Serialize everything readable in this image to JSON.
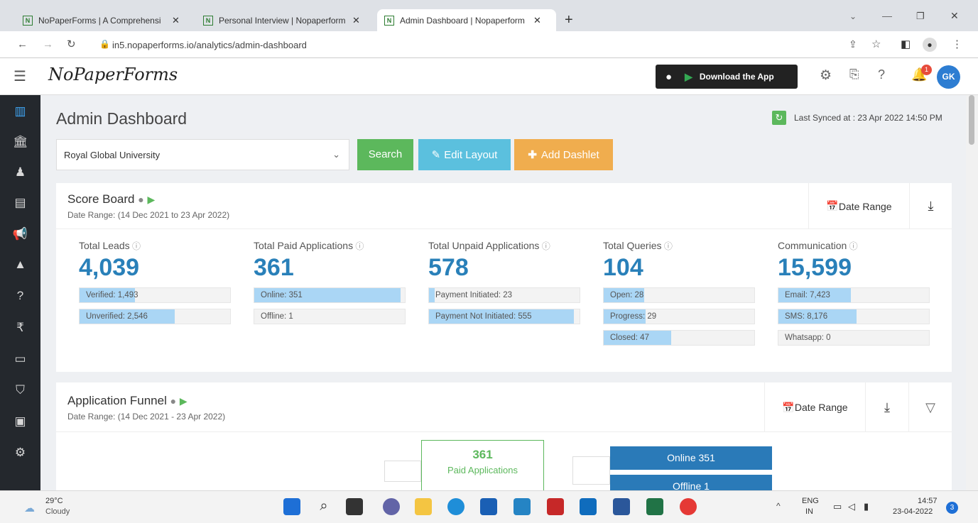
{
  "browser": {
    "tabs": [
      {
        "title": "NoPaperForms | A Comprehensi"
      },
      {
        "title": "Personal Interview | Nopaperform"
      },
      {
        "title": "Admin Dashboard | Nopaperform"
      }
    ],
    "url": "in5.nopaperforms.io/analytics/admin-dashboard",
    "fav_letter": "N"
  },
  "header": {
    "logo": "NoPaperForms",
    "download_label": "Download the App",
    "notif_count": "1",
    "avatar": "GK"
  },
  "page": {
    "title": "Admin Dashboard",
    "sync": "Last Synced at : 23 Apr 2022 14:50 PM",
    "university": "Royal Global University",
    "search_label": "Search",
    "edit_label": "Edit Layout",
    "add_label": "Add Dashlet"
  },
  "scoreboard": {
    "title": "Score Board",
    "date_range": "Date Range: (14 Dec 2021 to 23 Apr 2022)",
    "range_btn": "Date Range",
    "metrics": [
      {
        "label": "Total Leads",
        "value": "4,039",
        "bars": [
          {
            "text": "Verified: 1,493",
            "pct": 0.37
          },
          {
            "text": "Unverified: 2,546",
            "pct": 0.63
          }
        ]
      },
      {
        "label": "Total Paid Applications",
        "value": "361",
        "bars": [
          {
            "text": "Online: 351",
            "pct": 0.97
          },
          {
            "text": "Offline: 1",
            "pct": 0.0
          }
        ]
      },
      {
        "label": "Total Unpaid Applications",
        "value": "578",
        "bars": [
          {
            "text": "Payment Initiated: 23",
            "pct": 0.04
          },
          {
            "text": "Payment Not Initiated: 555",
            "pct": 0.96
          }
        ]
      },
      {
        "label": "Total Queries",
        "value": "104",
        "bars": [
          {
            "text": "Open: 28",
            "pct": 0.27
          },
          {
            "text": "Progress: 29",
            "pct": 0.28
          },
          {
            "text": "Closed: 47",
            "pct": 0.45
          }
        ]
      },
      {
        "label": "Communication",
        "value": "15,599",
        "bars": [
          {
            "text": "Email: 7,423",
            "pct": 0.48
          },
          {
            "text": "SMS: 8,176",
            "pct": 0.52
          },
          {
            "text": "Whatsapp: 0",
            "pct": 0.0
          }
        ]
      }
    ]
  },
  "funnel": {
    "title": "Application Funnel",
    "date_range": "Date Range: (14 Dec 2021 - 23 Apr 2022)",
    "range_btn": "Date Range",
    "node_value": "361",
    "node_label": "Paid Applications",
    "online": "Online 351",
    "offline": "Offline 1"
  },
  "taskbar": {
    "temp": "29°C",
    "weather": "Cloudy",
    "lang1": "ENG",
    "lang2": "IN",
    "time": "14:57",
    "date": "23-04-2022",
    "badge": "3"
  },
  "colors": {
    "green": "#5cb85c",
    "blue": "#5bc0de",
    "orange": "#f0ad4e",
    "accent": "#2980b9"
  }
}
